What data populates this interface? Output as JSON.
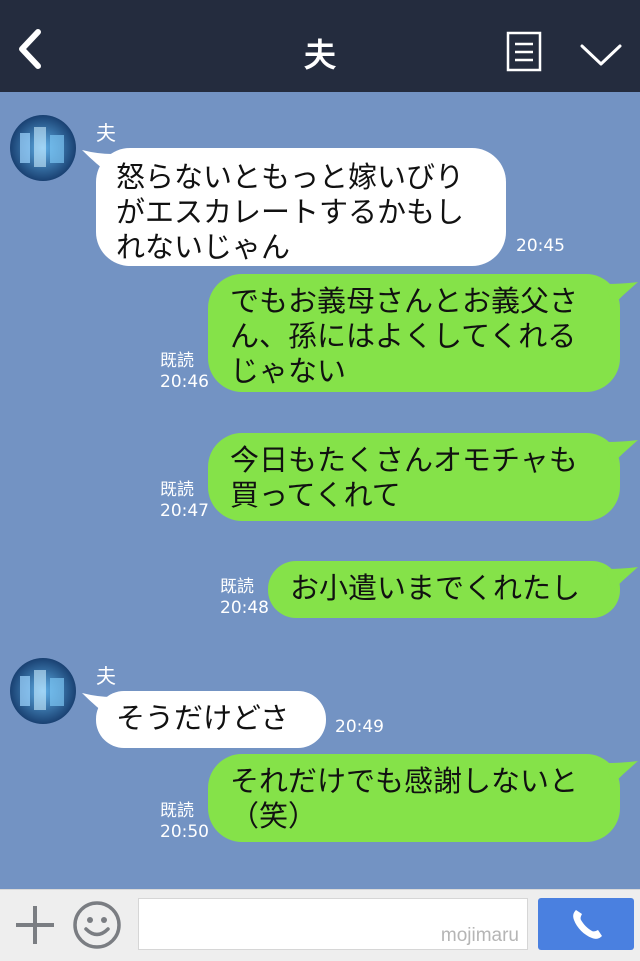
{
  "header": {
    "title": "夫",
    "back_icon": "chevron-left-icon",
    "menu_icon": "notes-icon",
    "expand_icon": "chevron-down-icon"
  },
  "messages": [
    {
      "direction": "in",
      "sender": "夫",
      "text": "怒らないともっと嫁いびり\nがエスカレートするかもし\nれないじゃん",
      "time": "20:45"
    },
    {
      "direction": "out",
      "read": "既読",
      "text": "でもお義母さんとお義父さ\nん、孫にはよくしてくれる\nじゃない",
      "time": "20:46"
    },
    {
      "direction": "out",
      "read": "既読",
      "text": "今日もたくさんオモチャも\n買ってくれて",
      "time": "20:47"
    },
    {
      "direction": "out",
      "read": "既読",
      "text": "お小遣いまでくれたし",
      "time": "20:48"
    },
    {
      "direction": "in",
      "sender": "夫",
      "text": "そうだけどさ",
      "time": "20:49"
    },
    {
      "direction": "out",
      "read": "既読",
      "text": "それだけでも感謝しないと\n（笑）",
      "time": "20:50"
    }
  ],
  "inputbar": {
    "plus_icon": "plus-icon",
    "emoji_icon": "smiley-icon",
    "watermark": "mojimaru",
    "call_icon": "phone-icon"
  },
  "colors": {
    "background": "#7393c3",
    "header": "#242c3e",
    "incoming_bubble": "#ffffff",
    "outgoing_bubble": "#85e249",
    "call_button": "#4a80e0"
  }
}
